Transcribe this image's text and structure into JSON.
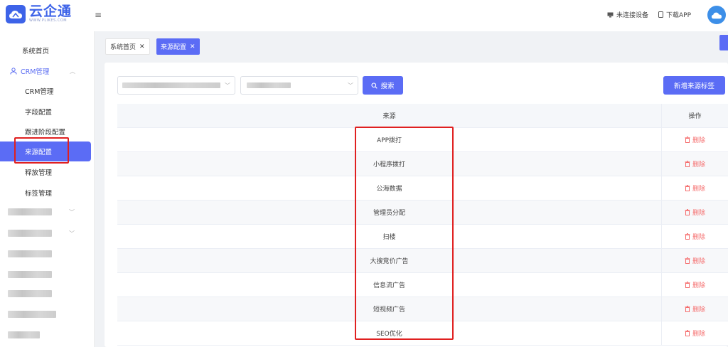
{
  "header": {
    "logo_title": "云企通",
    "logo_sub": "WWW.PLIKES.COM",
    "device_status": "未连接设备",
    "download_app": "下载APP"
  },
  "sidebar": {
    "home": "系统首页",
    "group_crm": "CRM管理",
    "items": [
      "CRM管理",
      "字段配置",
      "跟进阶段配置",
      "来源配置",
      "释放管理",
      "标签管理"
    ],
    "active_index": 3
  },
  "tabs": [
    {
      "label": "系统首页",
      "active": false
    },
    {
      "label": "来源配置",
      "active": true
    }
  ],
  "toolbar": {
    "search_label": "搜索",
    "add_label": "新增来源标签"
  },
  "table": {
    "columns": [
      "来源",
      "操作"
    ],
    "rows": [
      "APP拨打",
      "小程序拨打",
      "公海数据",
      "管理员分配",
      "扫楼",
      "大搜竞价广告",
      "信息流广告",
      "短视频广告",
      "SEO优化"
    ],
    "delete_label": "删除"
  },
  "colors": {
    "accent": "#5b6cf5",
    "danger": "#f56c6c",
    "highlight": "#e02020"
  }
}
